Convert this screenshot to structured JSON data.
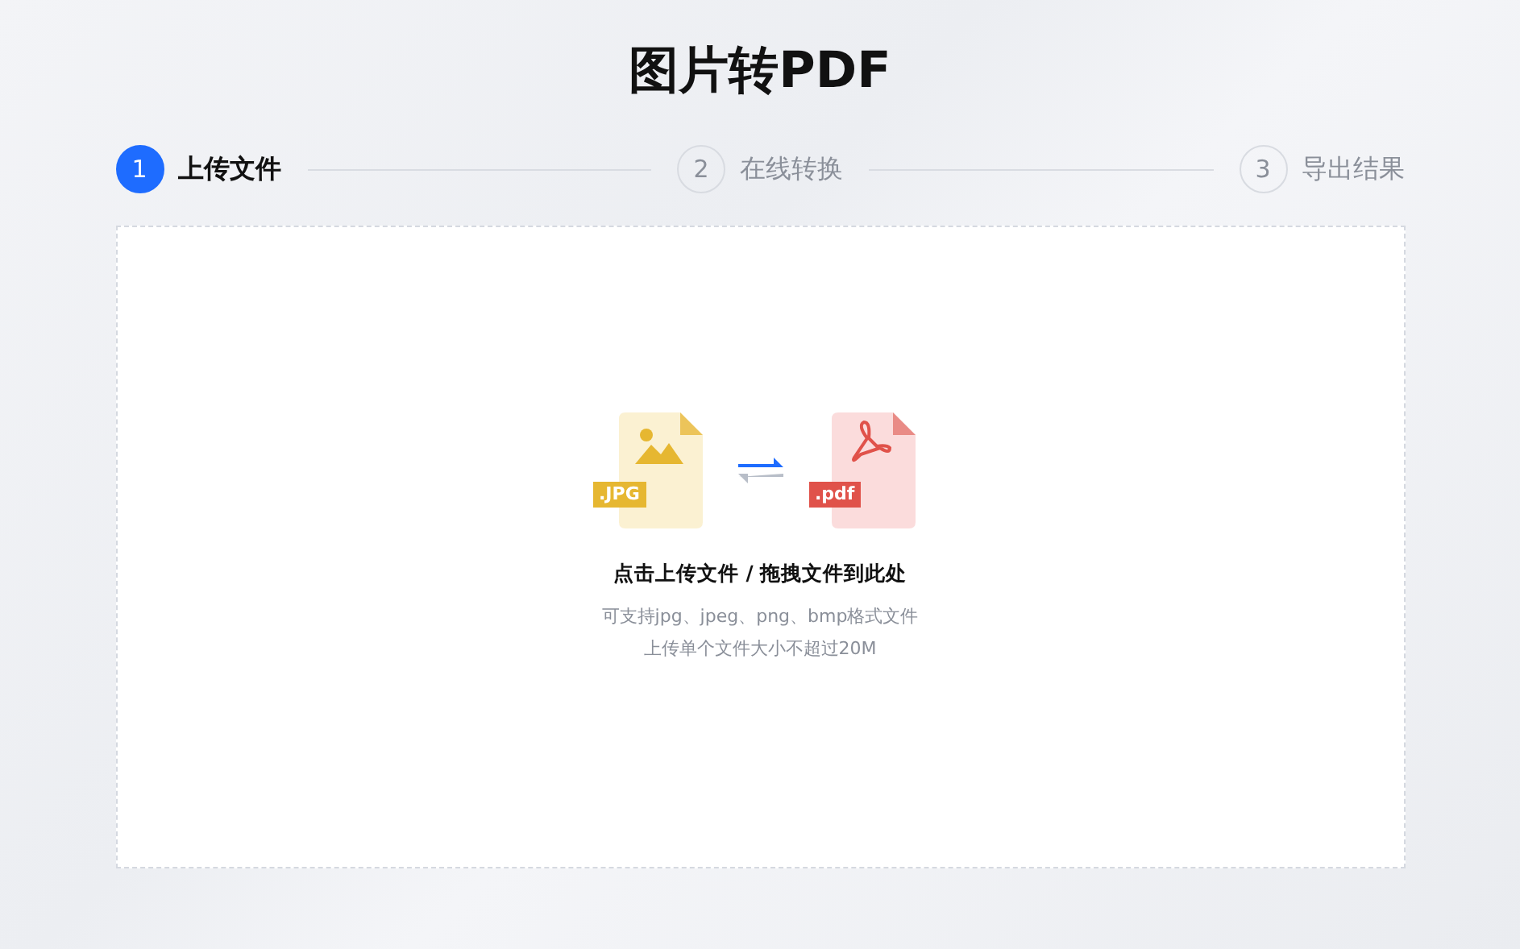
{
  "title": "图片转PDF",
  "steps": [
    {
      "number": "1",
      "label": "上传文件",
      "selected": true
    },
    {
      "number": "2",
      "label": "在线转换",
      "selected": false
    },
    {
      "number": "3",
      "label": "导出结果",
      "selected": false
    }
  ],
  "upload": {
    "source_badge": ".JPG",
    "target_badge": ".pdf",
    "prompt": "点击上传文件 / 拖拽文件到此处",
    "formats": "可支持jpg、jpeg、png、bmp格式文件",
    "limit": "上传单个文件大小不超过20M"
  }
}
